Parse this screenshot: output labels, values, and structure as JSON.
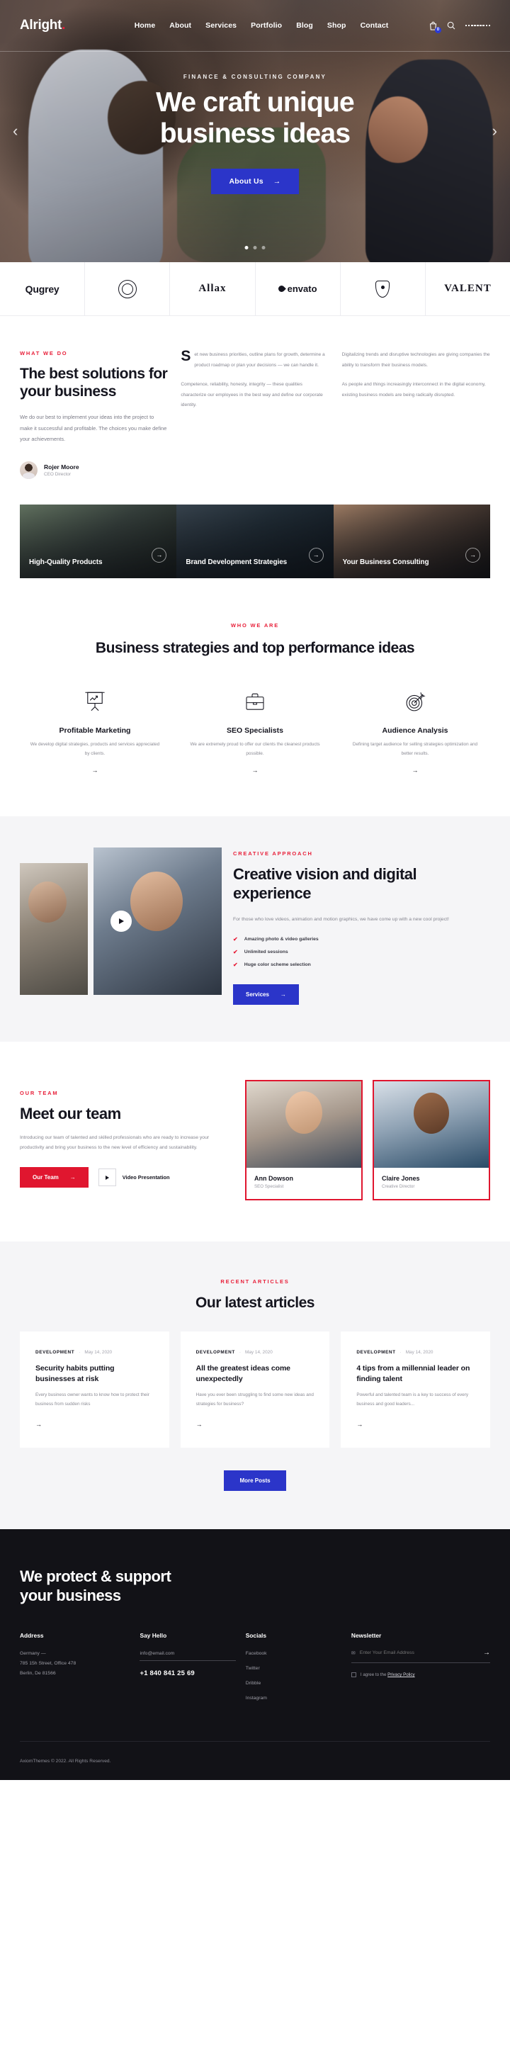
{
  "header": {
    "logo": "Alright",
    "logo_dot": ".",
    "nav": [
      {
        "label": "Home"
      },
      {
        "label": "About"
      },
      {
        "label": "Services"
      },
      {
        "label": "Portfolio"
      },
      {
        "label": "Blog"
      },
      {
        "label": "Shop"
      },
      {
        "label": "Contact"
      }
    ],
    "cart_count": "0"
  },
  "hero": {
    "kicker": "FINANCE & CONSULTING COMPANY",
    "title_line1": "We craft unique",
    "title_line2": "business ideas",
    "button": "About Us",
    "arrow": "→",
    "prev": "‹",
    "next": "›"
  },
  "brands": [
    {
      "name": "Qugrey",
      "type": "text"
    },
    {
      "name": "ring-mark",
      "type": "ring"
    },
    {
      "name": "Allax",
      "type": "serif"
    },
    {
      "name": "envato",
      "type": "mark"
    },
    {
      "name": "shield-mark",
      "type": "shield"
    },
    {
      "name": "VALENT",
      "type": "serif"
    }
  ],
  "what_we_do": {
    "kicker": "WHAT WE DO",
    "title": "The best solutions for your business",
    "intro": "We do our best to implement your ideas into the project to make it successful and profitable. The choices you make define your achievements.",
    "col2_dropcap": "S",
    "col2_p1": "et new business priorities, outline plans for growth, determine a product roadmap or plan your decisions — we can handle it.",
    "col2_p2": "Competence, reliability, honesty, integrity — these qualities characterize our employees in the best way and define our corporate identity.",
    "col3_p1": "Digitalizing trends and disruptive technologies are giving companies the ability to transform their business models.",
    "col3_p2": "As people and things increasingly interconnect in the digital economy, existing business models are being radically disrupted.",
    "author_name": "Rojer Moore",
    "author_role": "CEO Director"
  },
  "tiles": [
    {
      "title": "High-Quality Products",
      "arrow": "→"
    },
    {
      "title": "Brand Development Strategies",
      "arrow": "→"
    },
    {
      "title": "Your Business Consulting",
      "arrow": "→"
    }
  ],
  "who_we_are": {
    "kicker": "WHO WE ARE",
    "title": "Business strategies and top performance ideas",
    "features": [
      {
        "icon": "presentation-chart-icon",
        "title": "Profitable Marketing",
        "desc": "We develop digital strategies, products and services appreciated by clients.",
        "arrow": "→"
      },
      {
        "icon": "briefcase-icon",
        "title": "SEO Specialists",
        "desc": "We are extremely proud to offer our clients the cleanest products possible.",
        "arrow": "→"
      },
      {
        "icon": "target-dart-icon",
        "title": "Audience Analysis",
        "desc": "Defining target audience for selling strategies optimization and better results.",
        "arrow": "→"
      }
    ]
  },
  "creative": {
    "kicker": "CREATIVE APPROACH",
    "title": "Creative vision and digital experience",
    "lead": "For those who love videos, animation and motion graphics, we have come up with a new cool project!",
    "checks": [
      "Amazing photo & video galleries",
      "Unlimited sessions",
      "Huge color scheme selection"
    ],
    "button": "Services",
    "button_arrow": "→"
  },
  "team": {
    "kicker": "OUR TEAM",
    "title": "Meet our team",
    "desc": "Introducing our team of talented and skilled professionals who are ready to increase your productivity and bring your business to the new level of efficiency and sustainability.",
    "button": "Our Team",
    "button_arrow": "→",
    "video_label": "Video Presentation",
    "members": [
      {
        "name": "Ann Dowson",
        "role": "SEO Specialist"
      },
      {
        "name": "Claire Jones",
        "role": "Creative Director"
      }
    ]
  },
  "articles": {
    "kicker": "RECENT ARTICLES",
    "title": "Our latest articles",
    "items": [
      {
        "category": "DEVELOPMENT",
        "sep": "·",
        "date": "May 14, 2020",
        "title": "Security habits putting businesses at risk",
        "excerpt": "Every business owner wants to know how to protect their business from sudden risks",
        "arrow": "→"
      },
      {
        "category": "DEVELOPMENT",
        "sep": "·",
        "date": "May 14, 2020",
        "title": "All the greatest ideas come unexpectedly",
        "excerpt": "Have you ever been struggling to find some new ideas and strategies for business?",
        "arrow": "→"
      },
      {
        "category": "DEVELOPMENT",
        "sep": "·",
        "date": "May 14, 2020",
        "title": "4 tips from a millennial leader on finding talent",
        "excerpt": "Powerful and talented team is a key to success of every business and good leaders...",
        "arrow": "→"
      }
    ],
    "more_button": "More Posts"
  },
  "footer": {
    "title_line1": "We protect & support",
    "title_line2": "your business",
    "address_heading": "Address",
    "address_line1": "Germany —",
    "address_line2": "785 15h Street, Office 478",
    "address_line3": "Berlin, De 81566",
    "hello_heading": "Say Hello",
    "email": "info@email.com",
    "phone": "+1 840 841 25 69",
    "socials_heading": "Socials",
    "socials": [
      "Facebook",
      "Twitter",
      "Dribble",
      "Instagram"
    ],
    "newsletter_heading": "Newsletter",
    "newsletter_placeholder": "Enter Your Email Address",
    "newsletter_arrow": "→",
    "agree_text": "I agree to the ",
    "privacy_link": "Privacy Policy",
    "copyright": "AxiomThemes © 2022. All Rights Reserved."
  }
}
